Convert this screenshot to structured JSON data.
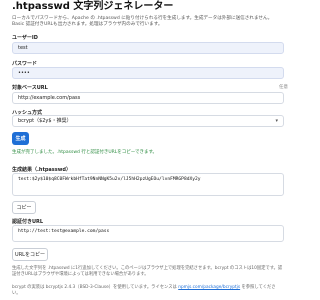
{
  "title": ".htpasswd 文字列ジェネレーター",
  "intro": "ローカルでパスワードから、Apache の .htpasswd に貼り付けられる行を生成します。生成データは外部に送信されません。Basic 認証付きURLも出力されます。処理はブラウザ内のみで行います。",
  "username": {
    "label": "ユーザーID",
    "value": "test"
  },
  "password": {
    "label": "パスワード",
    "value": "••••"
  },
  "target_url": {
    "label": "対象ベースURL",
    "hint": "任意",
    "value": "http://example.com/pass"
  },
  "hash": {
    "label": "ハッシュ方式",
    "selected": "bcrypt（$2y$・推奨）"
  },
  "generate_label": "生成",
  "success_message": "生成が完了しました。.htpasswd 行と認証付きURLをコピーできます。",
  "result": {
    "label": "生成結果（.htpasswd）",
    "value": "test:$2y$10$q8C0FWrkbHfTat9NnNNgK5u2v/lJ5hH2pzUgEOu/lvnFMRGP8dXy2y",
    "copy_label": "コピー"
  },
  "auth_url": {
    "label": "認証付きURL",
    "value": "http://test:test@example.com/pass",
    "copy_label": "URLをコピー"
  },
  "footer_note": "生成した文字列を .htpasswd に1行追加してください。このページはブラウザ上で処理を完結させます。bcrypt のコストは10固定です。認証付きURLはブラウザや環境によっては利用できない場合があります。",
  "credit": {
    "text": "bcrypt の実装は bcryptjs 2.4.3（BSD-3-Clause）を使用しています。ライセンスは ",
    "link": "npmjs.com/package/bcryptjs",
    "suffix": " を参照してください。"
  }
}
